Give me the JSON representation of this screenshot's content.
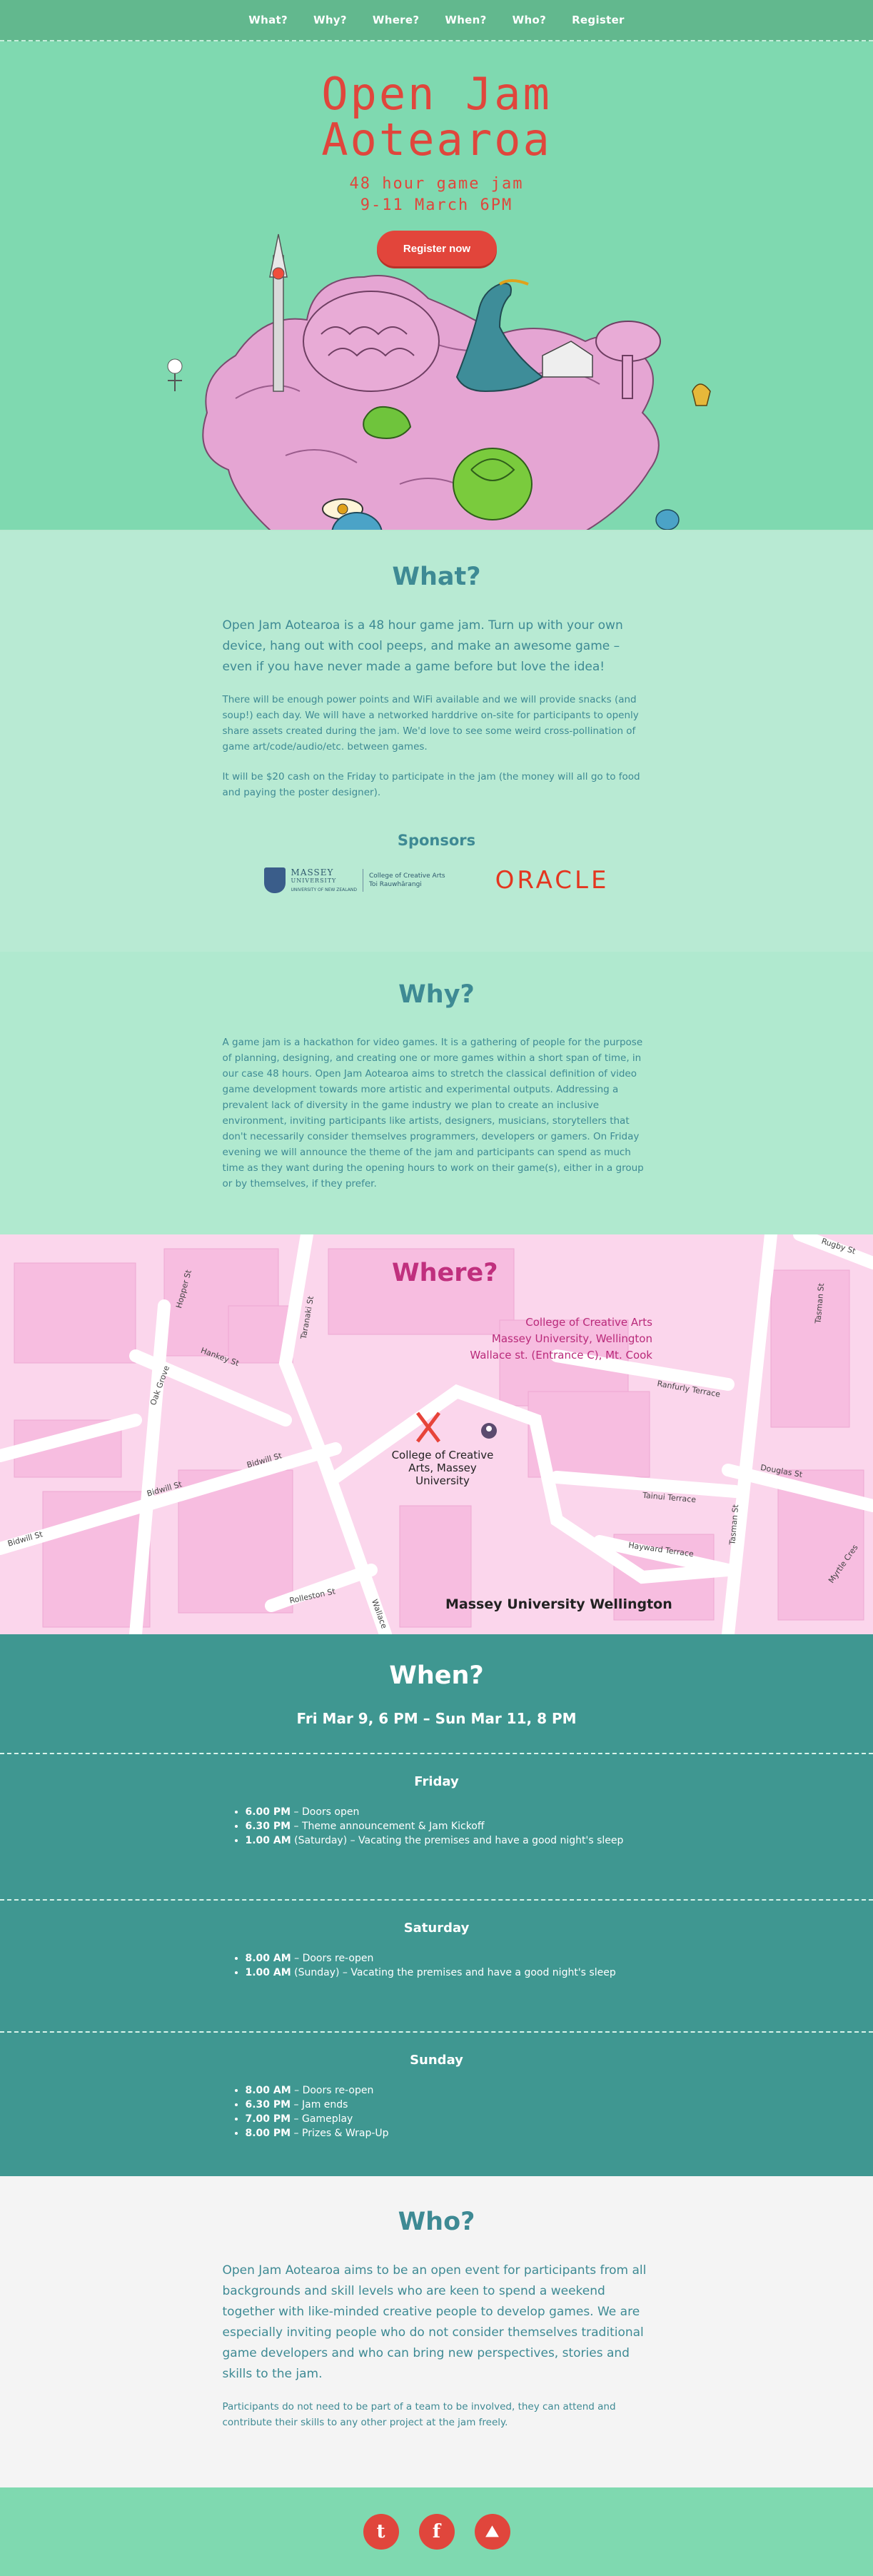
{
  "nav": [
    "What?",
    "Why?",
    "Where?",
    "When?",
    "Who?",
    "Register"
  ],
  "hero": {
    "title_line1": "Open Jam",
    "title_line2": "Aotearoa",
    "sub_line1": "48 hour game jam",
    "sub_line2": "9-11 March 6PM",
    "register": "Register now"
  },
  "what": {
    "title": "What?",
    "lead": "Open Jam Aotearoa is a 48 hour game jam. Turn up with your own device, hang out with cool peeps, and make an awesome game – even if you have never made a game before but love the idea!",
    "p1": "There will be enough power points and WiFi available and we will provide snacks (and soup!) each day. We will have a networked harddrive on-site for participants to openly share assets created during the jam. We'd love to see some weird cross-pollination of game art/code/audio/etc. between games.",
    "p2": "It will be $20 cash on the Friday to participate in the jam (the money will all go to food and paying the poster designer).",
    "sponsors_title": "Sponsors",
    "massey_name": "MASSEY",
    "massey_name2": "UNIVERSITY",
    "massey_tag": "UNIVERSITY OF NEW ZEALAND",
    "massey_cca1": "College of Creative Arts",
    "massey_cca2": "Toi Rauwhārangi",
    "oracle": "ORACLE"
  },
  "why": {
    "title": "Why?",
    "text": "A game jam is a hackathon for video games. It is a gathering of people for the purpose of planning, designing, and creating one or more games within a short span of time, in our case 48 hours. Open Jam Aotearoa aims to stretch the classical definition of video game development towards more artistic and experimental outputs. Addressing a prevalent lack of diversity in the game industry we plan to create an inclusive environment, inviting participants like artists, designers, musicians, storytellers that don't necessarily consider themselves programmers, developers or gamers. On Friday evening we will announce the theme of the jam and participants can spend as much time as they want during the opening hours to work on their game(s), either in a group or by themselves, if they prefer."
  },
  "where": {
    "title": "Where?",
    "addr1": "College of Creative Arts",
    "addr2": "Massey University, Wellington",
    "addr3": "Wallace st. (Entrance C), Mt. Cook",
    "pin": "College of Creative Arts, Massey University",
    "massey": "Massey University Wellington",
    "streets": {
      "hopper": "Hopper St",
      "hankey": "Hankey St",
      "tasman": "Tasman St",
      "rugby": "Rugby St",
      "taranaki": "Taranaki St",
      "oak": "Oak Grove",
      "bidwill1": "Bidwill St",
      "bidwill2": "Bidwill St",
      "bidwill3": "Bidwill St",
      "ranfurly": "Ranfurly Terrace",
      "douglas": "Douglas St",
      "tainui": "Tainui Terrace",
      "hayward": "Hayward Terrace",
      "myrtle": "Myrtle Cres",
      "rolleston": "Rolleston St",
      "wallace": "Wallace",
      "tasman2": "Tasman St"
    }
  },
  "when": {
    "title": "When?",
    "range": "Fri Mar 9, 6 PM – Sun Mar 11, 8 PM",
    "days": [
      {
        "name": "Friday",
        "items": [
          {
            "time": "6.00 PM",
            "text": " – Doors open"
          },
          {
            "time": "6.30 PM",
            "text": " – Theme announcement & Jam Kickoff"
          },
          {
            "time": "1.00 AM",
            "text": " (Saturday) – Vacating the premises and have a good night's sleep"
          }
        ]
      },
      {
        "name": "Saturday",
        "items": [
          {
            "time": "8.00 AM",
            "text": " – Doors re-open"
          },
          {
            "time": "1.00 AM",
            "text": " (Sunday) – Vacating the premises and have a good night's sleep"
          }
        ]
      },
      {
        "name": "Sunday",
        "items": [
          {
            "time": "8.00 AM",
            "text": " – Doors re-open"
          },
          {
            "time": "6.30 PM",
            "text": " – Jam ends"
          },
          {
            "time": "7.00 PM",
            "text": " – Gameplay"
          },
          {
            "time": "8.00 PM",
            "text": " – Prizes & Wrap-Up"
          }
        ]
      }
    ]
  },
  "who": {
    "title": "Who?",
    "lead": "Open Jam Aotearoa aims to be an open event for participants from all backgrounds and skill levels who are keen to spend a weekend together with like-minded creative people to develop games. We are especially inviting people who do not consider themselves traditional game developers and who can bring new perspectives, stories and skills to the jam.",
    "p": "Participants do not need to be part of a team to be involved, they can attend and contribute their skills to any other project at the jam freely."
  },
  "footer": {
    "icons": [
      "tumblr-icon",
      "facebook-icon",
      "itch-icon"
    ],
    "glyphs": [
      "t",
      "f",
      "⛰"
    ]
  }
}
